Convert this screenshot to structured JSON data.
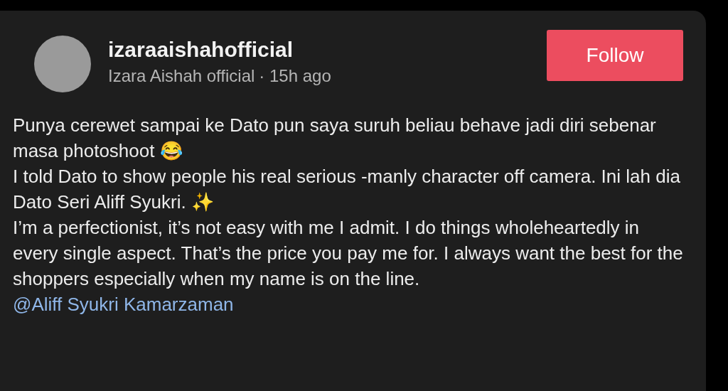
{
  "post": {
    "username": "izaraaishahofficial",
    "display_name": "Izara Aishah official",
    "time": "· 15h ago",
    "follow_button": "Follow",
    "paragraphs": [
      "Punya cerewet sampai ke Dato pun saya suruh beliau behave jadi diri sebenar masa photoshoot 😂",
      "I told Dato to show people his real serious -manly character off camera. Ini lah dia Dato Seri Aliff Syukri. ✨",
      "I’m a perfectionist, it’s not easy with me I admit. I do things wholeheartedly in every single aspect. That’s the price you pay me for. I always want the best for the shoppers especially when my name is on the line."
    ],
    "mention": "@Aliff Syukri Kamarzaman"
  }
}
